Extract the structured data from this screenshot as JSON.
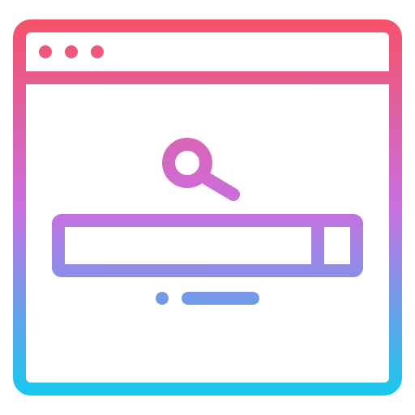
{
  "icon": {
    "name": "browser-search-icon",
    "window_controls": [
      "window-dot-icon",
      "window-dot-icon",
      "window-dot-icon"
    ],
    "search_glyph": "magnifier-icon",
    "pager_indicators": [
      "pager-dot-icon",
      "pager-dash-icon"
    ]
  },
  "colors": {
    "gradient_top": "#F65268",
    "gradient_middle": "#C96FE2",
    "gradient_bottom": "#18C8EE",
    "background": "#FFFFFF"
  }
}
